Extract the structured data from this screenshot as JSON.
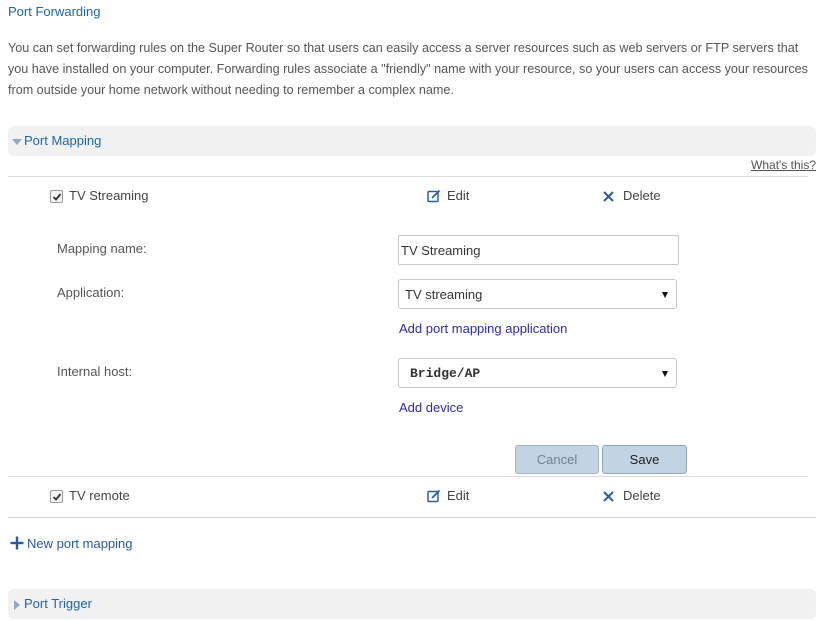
{
  "page": {
    "title": "Port Forwarding",
    "intro": "You can set forwarding rules on the Super Router so that users can easily access a server resources such as web servers or FTP servers that you have installed on your computer. Forwarding rules associate a \"friendly\" name with your resource, so your users can access your resources from outside your home network without needing to remember a complex name."
  },
  "port_mapping": {
    "section_label": "Port Mapping",
    "whats_this": "What's this?",
    "rows": [
      {
        "name": "TV Streaming",
        "checked": true,
        "edit_label": "Edit",
        "delete_label": "Delete"
      },
      {
        "name": "TV remote",
        "checked": true,
        "edit_label": "Edit",
        "delete_label": "Delete"
      }
    ],
    "form": {
      "mapping_name_label": "Mapping name:",
      "mapping_name_value": "TV Streaming",
      "application_label": "Application:",
      "application_value": "TV streaming",
      "add_application_link": "Add port mapping application",
      "internal_host_label": "Internal host:",
      "internal_host_value": "Bridge/AP",
      "add_device_link": "Add device",
      "cancel_label": "Cancel",
      "save_label": "Save"
    },
    "new_mapping_label": "New port mapping"
  },
  "port_trigger": {
    "section_label": "Port Trigger"
  },
  "colors": {
    "link_blue": "#1a66b0",
    "action_link": "#2a2ab8",
    "button_bg": "#c2d3e4",
    "section_bg": "#f1f1f1"
  },
  "icons": {
    "expanded": "triangle-down-icon",
    "collapsed": "triangle-right-icon",
    "edit": "pencil-square-icon",
    "delete": "x-icon",
    "add": "plus-icon",
    "checkbox": "checkmark-icon"
  }
}
